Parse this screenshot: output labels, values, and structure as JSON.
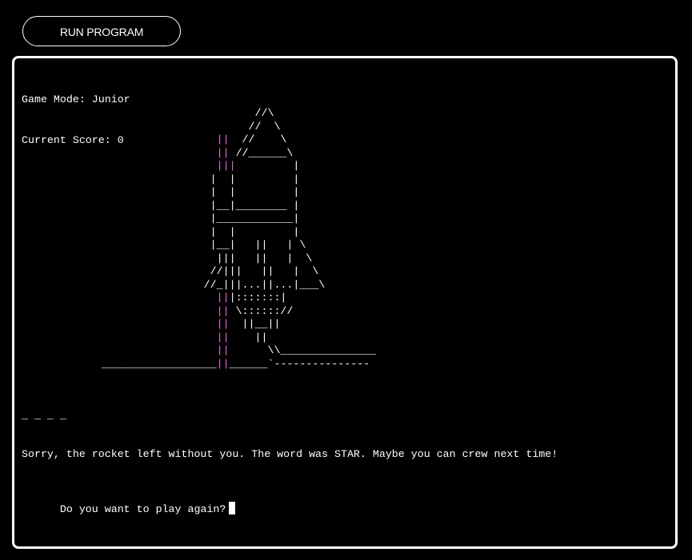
{
  "toolbar": {
    "run_label": "RUN PROGRAM"
  },
  "terminal": {
    "game_mode": "Game Mode: Junior",
    "current_score": "Current Score: 0",
    "word_blanks": "_ _ _ _",
    "message": "Sorry, the rocket left without you. The word was STAR. Maybe you can crew next time!",
    "prompt": "Do you want to play again?"
  },
  "rocket_art": [
    [
      [
        "w",
        "                        //\\"
      ]
    ],
    [
      [
        "w",
        "                       //  \\"
      ]
    ],
    [
      [
        "p",
        "                  ||"
      ],
      [
        "w",
        "  //    \\"
      ]
    ],
    [
      [
        "p",
        "                  ||"
      ],
      [
        "w",
        " //______\\"
      ]
    ],
    [
      [
        "p",
        "                  |||"
      ],
      [
        "w",
        "         |"
      ]
    ],
    [
      [
        "w",
        "                 |  |         |"
      ]
    ],
    [
      [
        "w",
        "                 |  |         |"
      ]
    ],
    [
      [
        "w",
        "                 |__|________ |"
      ]
    ],
    [
      [
        "w",
        "                 |____________|"
      ]
    ],
    [
      [
        "w",
        "                 |  |         |"
      ]
    ],
    [
      [
        "w",
        "                 |__|   ||   | \\"
      ]
    ],
    [
      [
        "w",
        "                  |||   ||   |  \\"
      ]
    ],
    [
      [
        "w",
        "                 //|||   ||   |  \\"
      ]
    ],
    [
      [
        "w",
        "                //_|||...||...|___\\"
      ]
    ],
    [
      [
        "p",
        "                  ||"
      ],
      [
        "w",
        "|:::::::|"
      ]
    ],
    [
      [
        "p",
        "                  ||"
      ],
      [
        "w",
        " \\:::::://"
      ]
    ],
    [
      [
        "p",
        "                  ||"
      ],
      [
        "w",
        "  ||__||"
      ]
    ],
    [
      [
        "p",
        "                  ||"
      ],
      [
        "w",
        "    ||"
      ]
    ],
    [
      [
        "p",
        "                  ||"
      ],
      [
        "w",
        "      \\\\_______________"
      ]
    ],
    [
      [
        "w",
        "__________________"
      ],
      [
        "p",
        "||"
      ],
      [
        "w",
        "______`---------------"
      ]
    ]
  ]
}
